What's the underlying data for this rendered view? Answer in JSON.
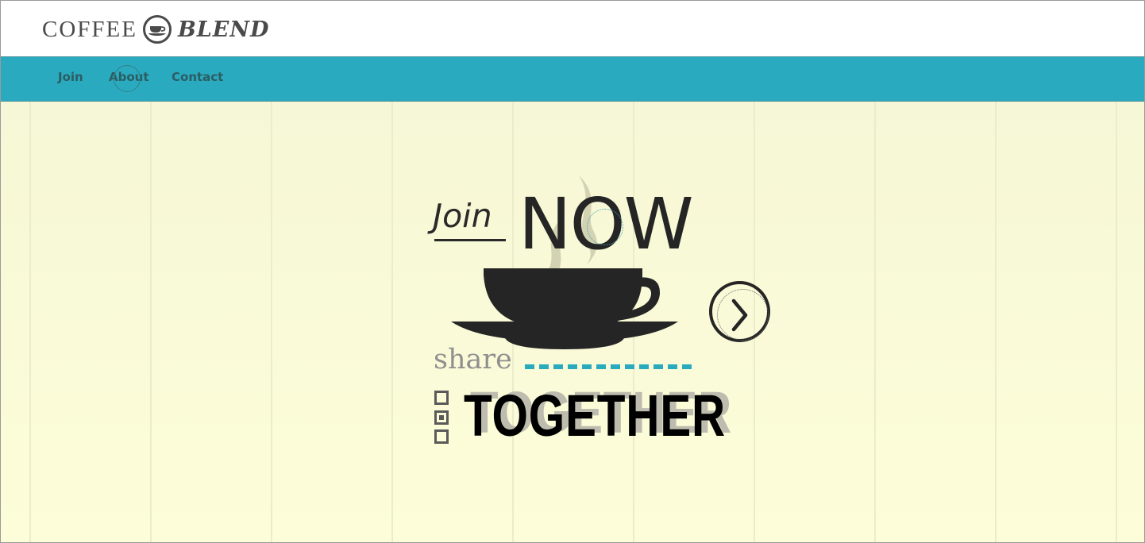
{
  "header": {
    "logo_word1": "COFFEE",
    "logo_word2": "BLEND"
  },
  "nav": {
    "items": [
      {
        "label": "Join"
      },
      {
        "label": "About"
      },
      {
        "label": "Contact"
      }
    ]
  },
  "hero": {
    "join_text": "Join",
    "now_text": "NOW",
    "share_text": "share",
    "together_text": "TOGETHER",
    "next_icon": "chevron-right-icon"
  },
  "colors": {
    "accent": "#2aaabf",
    "nav_text": "#2b5d63",
    "hero_background": "#f8f8d8",
    "ink": "#252525"
  }
}
